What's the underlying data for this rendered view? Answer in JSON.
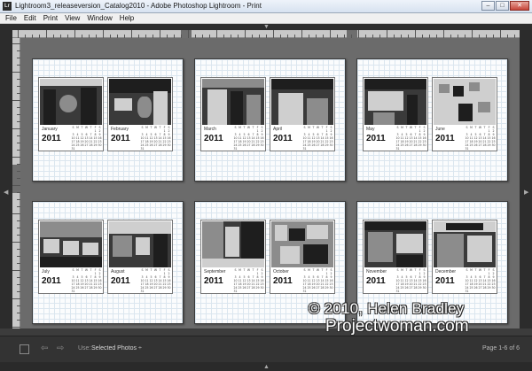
{
  "window": {
    "app_icon_text": "Lr",
    "title": "Lightroom3_releaseversion_Catalog2010 - Adobe Photoshop Lightroom - Print",
    "minimize_glyph": "–",
    "maximize_glyph": "□",
    "close_glyph": "✕"
  },
  "menu": [
    "File",
    "Edit",
    "Print",
    "View",
    "Window",
    "Help"
  ],
  "pages": [
    {
      "left": {
        "month": "January",
        "year": "2011",
        "icon": "photo-cafe"
      },
      "right": {
        "month": "February",
        "year": "2011",
        "icon": "photo-cafe"
      }
    },
    {
      "left": {
        "month": "March",
        "year": "2011",
        "icon": "photo-storefront"
      },
      "right": {
        "month": "April",
        "year": "2011",
        "icon": "photo-storefront"
      }
    },
    {
      "left": {
        "month": "May",
        "year": "2011",
        "icon": "photo-newsstand"
      },
      "right": {
        "month": "June",
        "year": "2011",
        "icon": "photo-postcards"
      }
    },
    {
      "left": {
        "month": "July",
        "year": "2011",
        "icon": "photo-bookstall"
      },
      "right": {
        "month": "August",
        "year": "2011",
        "icon": "photo-street"
      }
    },
    {
      "left": {
        "month": "September",
        "year": "2011",
        "icon": "photo-street"
      },
      "right": {
        "month": "October",
        "year": "2011",
        "icon": "photo-posters"
      }
    },
    {
      "left": {
        "month": "November",
        "year": "2011",
        "icon": "photo-shopfront"
      },
      "right": {
        "month": "December",
        "year": "2011",
        "icon": "photo-shopfront"
      }
    }
  ],
  "calendar_grid": [
    "S",
    "M",
    "T",
    "W",
    "T",
    "F",
    "S",
    "",
    "",
    "",
    "",
    "",
    "1",
    "2",
    "3",
    "4",
    "5",
    "6",
    "7",
    "8",
    "9",
    "10",
    "11",
    "12",
    "13",
    "14",
    "15",
    "16",
    "17",
    "18",
    "19",
    "20",
    "21",
    "22",
    "23",
    "24",
    "25",
    "26",
    "27",
    "28",
    "29",
    "30",
    "31"
  ],
  "watermark": {
    "line1": "© 2010, Helen Bradley",
    "line2": "Projectwoman.com"
  },
  "toolbar": {
    "use_label": "Use:",
    "use_value": "Selected Photos",
    "page_info": "Page 1-6 of 6"
  },
  "colors": {
    "canvas": "#6b6b6b",
    "page": "#fbfcfd",
    "toolbar": "#333333"
  }
}
